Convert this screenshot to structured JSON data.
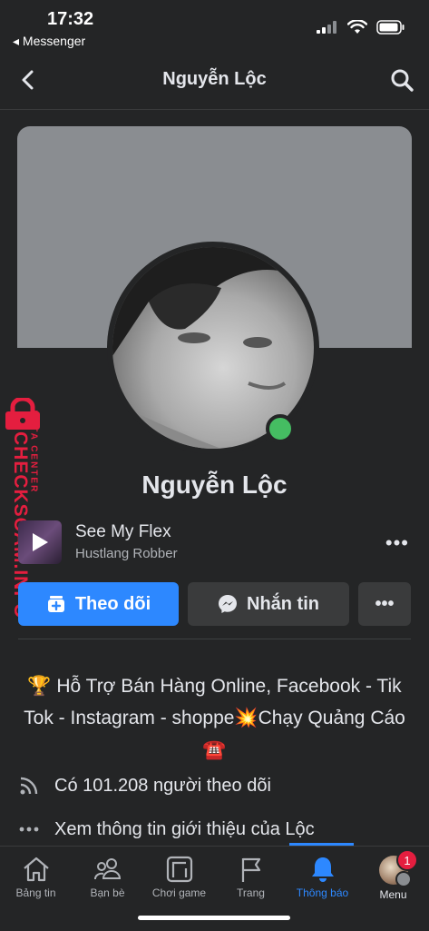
{
  "status_bar": {
    "time": "17:32",
    "back_app": "◂ Messenger"
  },
  "nav": {
    "title": "Nguyễn Lộc"
  },
  "profile": {
    "name": "Nguyễn Lộc",
    "online_color": "#45bd62"
  },
  "music": {
    "title": "See My Flex",
    "artist": "Hustlang Robber",
    "more": "•••"
  },
  "actions": {
    "follow_label": "Theo dõi",
    "message_label": "Nhắn tin",
    "more_label": "•••"
  },
  "bio": {
    "text": "🏆 Hỗ Trợ Bán Hàng Online, Facebook - Tik Tok - Instagram - shoppe💥Chạy Quảng Cáo ☎️"
  },
  "info": {
    "followers": "Có 101.208 người theo dõi",
    "about": "Xem thông tin giới thiệu của Lộc"
  },
  "watermark": {
    "brand": "CHECKSCAM.INFO",
    "sub": "DATA CENTER"
  },
  "tabs": [
    {
      "label": "Bảng tin",
      "icon": "home-icon"
    },
    {
      "label": "Bạn bè",
      "icon": "friends-icon"
    },
    {
      "label": "Chơi game",
      "icon": "gaming-icon"
    },
    {
      "label": "Trang",
      "icon": "flag-icon"
    },
    {
      "label": "Thông báo",
      "icon": "bell-icon",
      "active": true
    },
    {
      "label": "Menu",
      "icon": "avatar-icon"
    }
  ],
  "menu_badge": "1",
  "colors": {
    "accent": "#2d88ff",
    "background": "#242526",
    "button_secondary": "#3a3b3c",
    "badge": "#e41e3f"
  }
}
